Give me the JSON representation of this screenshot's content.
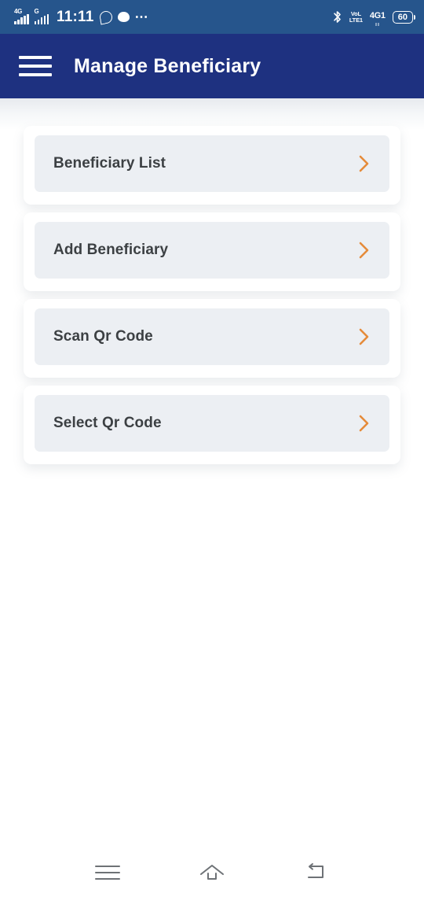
{
  "status_bar": {
    "network_left_tag": "4G",
    "network_right_tag": "G",
    "time": "11:11",
    "whatsapp_icon": "whatsapp-icon",
    "messenger_icon": "chat-bubble-icon",
    "overflow_icon": "more-dots-icon",
    "bluetooth_icon": "bluetooth-icon",
    "volte_line1": "VoL",
    "volte_line2": "LTE1",
    "data_label": "4G",
    "data_sim": "1",
    "battery_level": "60",
    "bg_color": "#26558c"
  },
  "app_bar": {
    "menu_icon": "hamburger-menu-icon",
    "title": "Manage Beneficiary",
    "bg_color": "#1e3180",
    "title_color": "#ffffff"
  },
  "menu": {
    "chevron_icon": "chevron-right-icon",
    "accent_color": "#e58b3a",
    "card_bg_color": "#eceff3",
    "label_color": "#3c4043",
    "items": [
      {
        "label": "Beneficiary List"
      },
      {
        "label": "Add Beneficiary"
      },
      {
        "label": "Scan Qr Code"
      },
      {
        "label": "Select Qr Code"
      }
    ]
  },
  "nav_bar": {
    "recents_icon": "recents-menu-icon",
    "home_icon": "home-icon",
    "back_icon": "back-arrow-icon",
    "icon_color": "#6e7276"
  }
}
